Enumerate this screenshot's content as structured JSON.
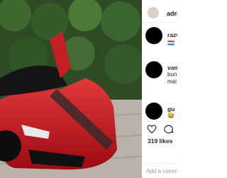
{
  "post": {
    "username": "adri",
    "image_description": "car-photo"
  },
  "comments": [
    {
      "name": "razv",
      "text": "",
      "emoji": "🇱🇺"
    },
    {
      "name": "van",
      "text": "bun",
      "text2": "mai"
    },
    {
      "name": "gu",
      "text": "",
      "emoji": "😂"
    }
  ],
  "actions": {
    "likes": "319 likes",
    "add_comment_placeholder": "Add a comment..."
  }
}
